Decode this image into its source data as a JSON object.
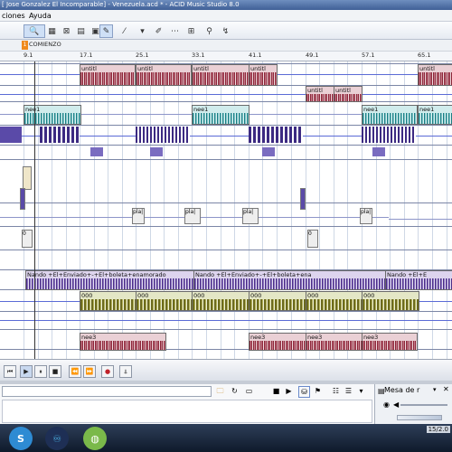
{
  "window": {
    "title": "[ Jose Gonzalez El Incomparable] - Venezuela.acd * - ACID Music Studio 8.0"
  },
  "menu": {
    "items": [
      "ciones",
      "Ayuda"
    ]
  },
  "markers": {
    "comienzo": "COMIENZO",
    "flag": "1"
  },
  "ruler": {
    "labels": [
      "9.1",
      "17.1",
      "25.1",
      "33.1",
      "41.1",
      "49.1",
      "57.1",
      "65.1"
    ]
  },
  "clips": {
    "untitled": "untitl",
    "nee1": "nee1",
    "nee3": "nee3",
    "nando_full": "Nando +El+Enviado+-+El+boleta+enamorado",
    "nando_short": "Nando +El+Enviado+-+El+boleta+ena",
    "nando_end": "Nando +El+E",
    "loop000": "000",
    "fx_a": "0",
    "fx_b": "0",
    "pala": "pla|"
  },
  "explorer": {
    "path": ""
  },
  "mixer": {
    "label": "Mesa de r"
  },
  "clock": {
    "date": "15/2.0"
  },
  "colors": {
    "accent": "#3f5f96",
    "clip_red": "#8a2436",
    "clip_teal": "#1d7d83",
    "clip_purple": "#4b2f86",
    "clip_olive": "#6c6a1e"
  }
}
